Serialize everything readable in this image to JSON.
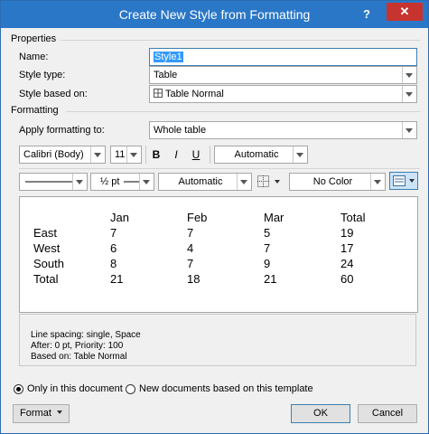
{
  "window": {
    "title": "Create New Style from Formatting",
    "help": "?",
    "close": "✕"
  },
  "properties": {
    "section": "Properties",
    "name_label": "Name:",
    "name_value": "Style1",
    "style_type_label": "Style type:",
    "style_type_value": "Table",
    "based_on_label": "Style based on:",
    "based_on_value": "Table Normal",
    "based_on_icon": "table-icon"
  },
  "formatting": {
    "section": "Formatting",
    "apply_label": "Apply formatting to:",
    "apply_value": "Whole table",
    "font": "Calibri (Body)",
    "size": "11",
    "bold": "B",
    "italic": "I",
    "underline": "U",
    "font_color": "Automatic",
    "line_weight": "½ pt",
    "border_color": "Automatic",
    "shading": "No Color"
  },
  "preview": {
    "header": [
      "",
      "Jan",
      "Feb",
      "Mar",
      "Total"
    ],
    "rows": [
      [
        "East",
        "7",
        "7",
        "5",
        "19"
      ],
      [
        "West",
        "6",
        "4",
        "7",
        "17"
      ],
      [
        "South",
        "8",
        "7",
        "9",
        "24"
      ],
      [
        "Total",
        "21",
        "18",
        "21",
        "60"
      ]
    ]
  },
  "description": {
    "line1": "Line spacing:  single, Space",
    "line2": "After:  0 pt, Priority: 100",
    "line3": "Based on: Table Normal"
  },
  "options": {
    "only_doc": "Only in this document",
    "new_docs": "New documents based on this template",
    "selected": "only_doc"
  },
  "buttons": {
    "format": "Format",
    "ok": "OK",
    "cancel": "Cancel"
  },
  "colors": {
    "titlebar": "#2b77c7",
    "close": "#c7342f",
    "selection": "#3399ff"
  }
}
